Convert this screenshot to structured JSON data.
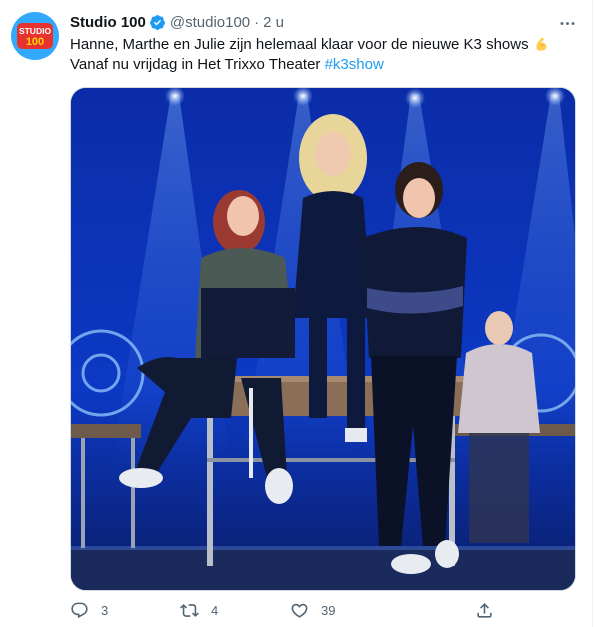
{
  "tweet": {
    "author_name": "Studio 100",
    "handle": "@studio100",
    "separator": "·",
    "time": "2 u",
    "avatar_text": "STUDIO 100",
    "text_line1": "Hanne, Marthe en Julie zijn helemaal klaar voor de nieuwe K3 shows",
    "text_line2": "Vanaf nu vrijdag in Het Trixxo Theater ",
    "hashtag": "#k3show",
    "emoji": "flexed-biceps-icon"
  },
  "actions": {
    "reply_count": "3",
    "retweet_count": "4",
    "like_count": "39"
  },
  "colors": {
    "accent": "#1d9bf0",
    "secondary_text": "#536471",
    "avatar_bg": "#33a8ff",
    "stage_blue": "#1437b8"
  }
}
